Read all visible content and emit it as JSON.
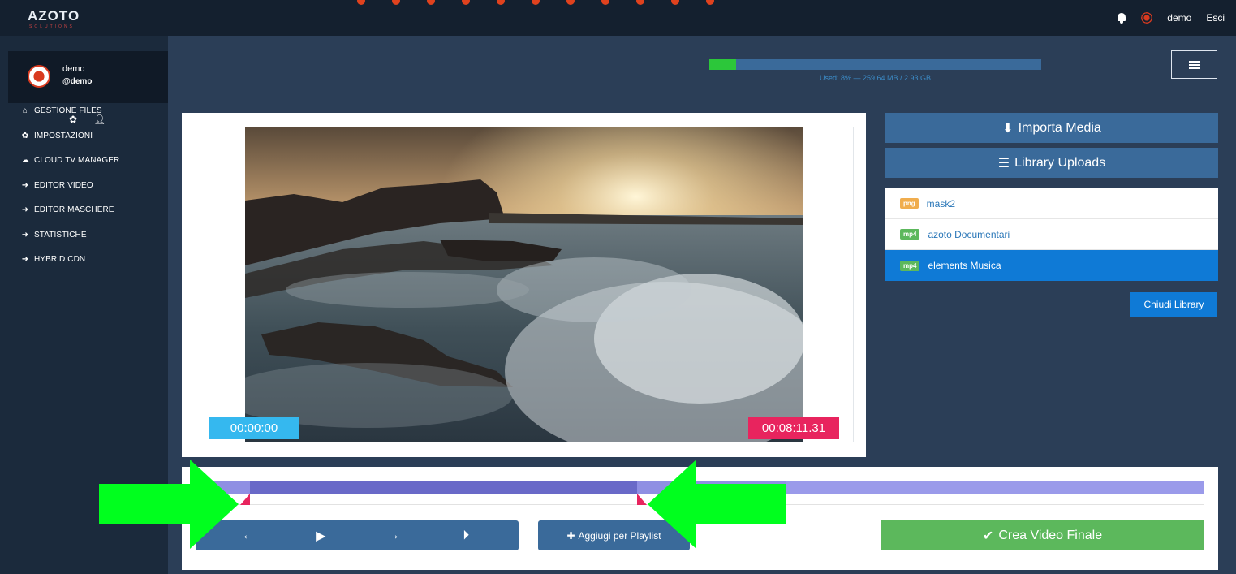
{
  "header": {
    "logo_text": "AZOTO",
    "logo_subtext": "SOLUTIONS",
    "username": "demo",
    "logout_label": "Esci"
  },
  "sidebar": {
    "user_name": "demo",
    "user_handle": "@demo",
    "items": [
      {
        "icon": "home-icon",
        "label": "GESTIONE FILES"
      },
      {
        "icon": "gear-icon",
        "label": "IMPOSTAZIONI"
      },
      {
        "icon": "cloud-icon",
        "label": "CLOUD TV MANAGER"
      },
      {
        "icon": "arrow-right-icon",
        "label": "EDITOR VIDEO"
      },
      {
        "icon": "arrow-right-icon",
        "label": "EDITOR MASCHERE"
      },
      {
        "icon": "arrow-right-icon",
        "label": "STATISTICHE"
      },
      {
        "icon": "arrow-right-icon",
        "label": "HYBRID CDN"
      }
    ]
  },
  "storage": {
    "used_fraction": 0.08,
    "label": "Used: 8% — 259.64 MB / 2.93 GB"
  },
  "player": {
    "start_time": "00:00:00",
    "end_time": "00:08:11.31"
  },
  "media_panel": {
    "import_label": "Importa Media",
    "library_label": "Library Uploads",
    "library_items": [
      {
        "type": "png",
        "name": "mask2",
        "selected": false
      },
      {
        "type": "mp4",
        "name": "azoto Documentari",
        "selected": false
      },
      {
        "type": "mp4",
        "name": "elements Musica",
        "selected": true
      }
    ],
    "close_library_label": "Chiudi Library"
  },
  "timeline": {
    "add_playlist_label": "Aggiugi per Playlist",
    "create_final_label": "Crea Video Finale"
  },
  "colors": {
    "accent_blue": "#3a6a9a",
    "selected_blue": "#0f7ad6",
    "success_green": "#5cb85c",
    "start_time_bg": "#35b8ef",
    "end_time_bg": "#e8245e",
    "annotation_green": "#00ff1e"
  }
}
